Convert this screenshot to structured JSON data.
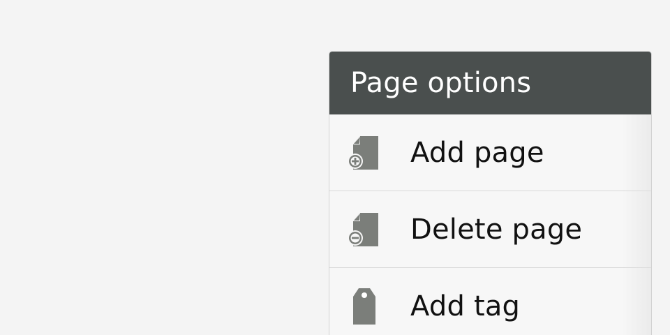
{
  "popup": {
    "title": "Page options",
    "items": [
      {
        "label": "Add page",
        "icon": "add-page-icon"
      },
      {
        "label": "Delete page",
        "icon": "delete-page-icon"
      },
      {
        "label": "Add tag",
        "icon": "tag-icon"
      }
    ]
  },
  "colors": {
    "background": "#f4f4f4",
    "header": "#4a4f4e",
    "header_text": "#ffffff",
    "icon": "#7b7e7a",
    "item_text": "#111111",
    "divider": "#d8d8d8"
  }
}
